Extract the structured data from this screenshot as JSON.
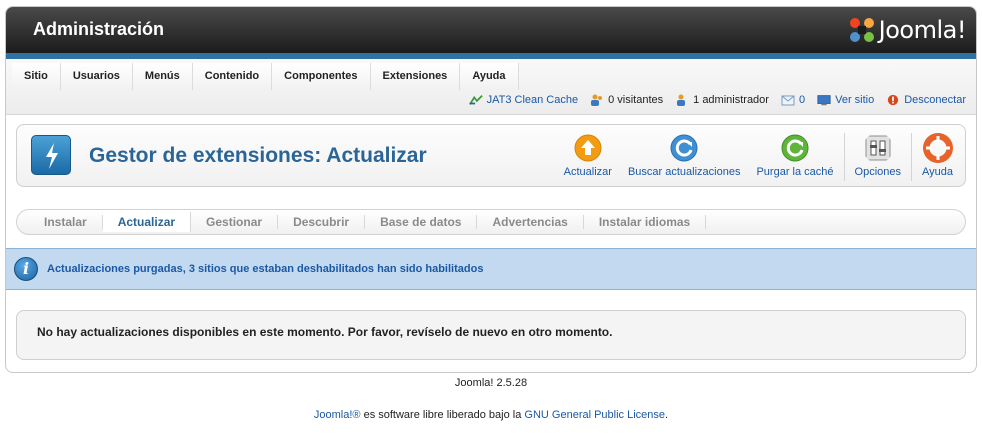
{
  "header": {
    "title": "Administración",
    "logo_text": "Joomla!",
    "logo_mark": "®"
  },
  "menu": [
    "Sitio",
    "Usuarios",
    "Menús",
    "Contenido",
    "Componentes",
    "Extensiones",
    "Ayuda"
  ],
  "status": {
    "cache": "JAT3 Clean Cache",
    "visitors": "0 visitantes",
    "admins": "1 administrador",
    "messages": "0",
    "view_site": "Ver sitio",
    "logout": "Desconectar"
  },
  "page": {
    "title": "Gestor de extensiones: Actualizar"
  },
  "toolbar": {
    "update": "Actualizar",
    "find_updates": "Buscar actualizaciones",
    "purge_cache": "Purgar la caché",
    "options": "Opciones",
    "help": "Ayuda"
  },
  "subnav": {
    "install": "Instalar",
    "update": "Actualizar",
    "manage": "Gestionar",
    "discover": "Descubrir",
    "database": "Base de datos",
    "warnings": "Advertencias",
    "languages": "Instalar idiomas"
  },
  "message": "Actualizaciones purgadas, 3 sitios que estaban deshabilitados han sido habilitados",
  "content": "No hay actualizaciones disponibles en este momento. Por favor, revíselo de nuevo en otro momento.",
  "footer": {
    "version": "Joomla! 2.5.28",
    "joomla_link": "Joomla!®",
    "middle": " es software libre liberado bajo la ",
    "license_link": "GNU General Public License",
    "end": "."
  },
  "colors": {
    "accent": "#2b6597",
    "link": "#1b58a5",
    "message_bg": "#c3d9ef",
    "header_bar": "#2f73a4"
  }
}
